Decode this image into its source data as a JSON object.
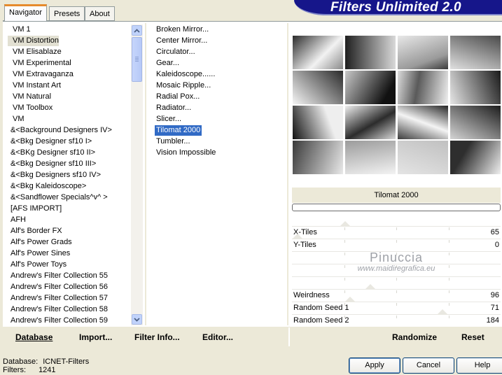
{
  "tabs": [
    {
      "label": "Navigator",
      "active": true
    },
    {
      "label": "Presets",
      "active": false
    },
    {
      "label": "About",
      "active": false
    }
  ],
  "app_title": "Filters Unlimited 2.0",
  "categories": [
    "VM 1",
    "VM Distortion",
    "VM Elisablaze",
    "VM Experimental",
    "VM Extravaganza",
    "VM Instant Art",
    "VM Natural",
    "VM Toolbox",
    "VM",
    "&<Background Designers IV>",
    "&<Bkg Designer sf10 I>",
    "&<BKg Designer sf10 II>",
    "&<Bkg Designer sf10 III>",
    "&<Bkg Designers sf10 IV>",
    "&<Bkg Kaleidoscope>",
    "&<Sandflower Specials^v^ >",
    "[AFS IMPORT]",
    "AFH",
    "Alf's Border FX",
    "Alf's Power Grads",
    "Alf's Power Sines",
    "Alf's Power Toys",
    "Andrew's Filter Collection 55",
    "Andrew's Filter Collection 56",
    "Andrew's Filter Collection 57",
    "Andrew's Filter Collection 58",
    "Andrew's Filter Collection 59"
  ],
  "selected_category": "VM Distortion",
  "filters": [
    "Broken Mirror...",
    "Center Mirror...",
    "Circulator...",
    "Gear...",
    "Kaleidoscope......",
    "Mosaic Ripple...",
    "Radial Pox...",
    "Radiator...",
    "Slicer...",
    "Tilomat 2000",
    "Tumbler...",
    "Vision Impossible"
  ],
  "selected_filter": "Tilomat 2000",
  "preview_title": "Tilomat 2000",
  "parameters": [
    {
      "label": "X-Tiles",
      "value": "65",
      "level": 0.255
    },
    {
      "label": "Y-Tiles",
      "value": "0",
      "level": 0
    },
    {
      "label": "",
      "value": "",
      "level": null
    },
    {
      "label": "",
      "value": "",
      "level": null
    },
    {
      "label": "",
      "value": "",
      "level": null
    },
    {
      "label": "Weirdness",
      "value": "96",
      "level": 0.376
    },
    {
      "label": "Random Seed 1",
      "value": "71",
      "level": 0.278
    },
    {
      "label": "Random Seed 2",
      "value": "184",
      "level": 0.722
    }
  ],
  "watermark": {
    "line1": "Pinuccia",
    "line2": "www.maidiregrafica.eu"
  },
  "commands": {
    "database": "Database",
    "import": "Import...",
    "filter_info": "Filter Info...",
    "editor": "Editor...",
    "randomize": "Randomize",
    "reset": "Reset"
  },
  "status": {
    "database_label": "Database:",
    "database_value": "ICNET-Filters",
    "filters_label": "Filters:",
    "filters_value": "1241"
  },
  "buttons": {
    "apply": "Apply",
    "cancel": "Cancel",
    "help": "Help"
  },
  "colors": {
    "selection": "#316ac5",
    "banner": "#16168a",
    "active_tab": "#e68b2c"
  }
}
